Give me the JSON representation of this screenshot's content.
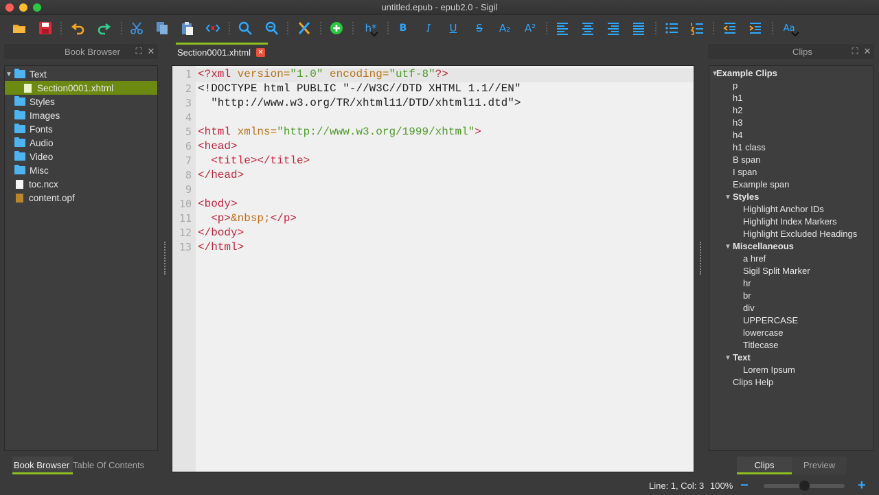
{
  "window": {
    "title": "untitled.epub - epub2.0 - Sigil"
  },
  "toolbar": {
    "heading_label": "h*",
    "bold_label": "B",
    "italic_label": "I",
    "underline_label": "U",
    "strike_label": "S",
    "subscript_label": "A₂",
    "superscript_label": "A²",
    "case_label": "Aa"
  },
  "left_panel": {
    "title": "Book Browser",
    "tree": [
      {
        "label": "Text",
        "type": "folder",
        "expanded": true
      },
      {
        "label": "Section0001.xhtml",
        "type": "file",
        "selected": true
      },
      {
        "label": "Styles",
        "type": "folder"
      },
      {
        "label": "Images",
        "type": "folder"
      },
      {
        "label": "Fonts",
        "type": "folder"
      },
      {
        "label": "Audio",
        "type": "folder"
      },
      {
        "label": "Video",
        "type": "folder"
      },
      {
        "label": "Misc",
        "type": "folder"
      },
      {
        "label": "toc.ncx",
        "type": "file"
      },
      {
        "label": "content.opf",
        "type": "file"
      }
    ],
    "tabs": [
      "Book Browser",
      "Table Of Contents"
    ]
  },
  "editor": {
    "tab_label": "Section0001.xhtml",
    "line_numbers": [
      "1",
      "2",
      "3",
      "4",
      "5",
      "6",
      "7",
      "8",
      "9",
      "10",
      "11",
      "12",
      "13"
    ],
    "lines": [
      {
        "tag_open": "<?xml ",
        "attr1": "version=",
        "str1": "\"1.0\"",
        "attr2": " encoding=",
        "str2": "\"utf-8\"",
        "tag_close": "?>"
      },
      {
        "text": "<!DOCTYPE html PUBLIC \"-//W3C//DTD XHTML 1.1//EN\""
      },
      {
        "text": "  \"http://www.w3.org/TR/xhtml11/DTD/xhtml11.dtd\">"
      },
      {
        "text": ""
      },
      {
        "tag_open": "<html ",
        "attr1": "xmlns=",
        "str1": "\"http://www.w3.org/1999/xhtml\"",
        "tag_close": ">"
      },
      {
        "tag": "<head>"
      },
      {
        "tag": "  <title></title>"
      },
      {
        "tag": "</head>"
      },
      {
        "text": ""
      },
      {
        "tag": "<body>"
      },
      {
        "tag_open": "  <p>",
        "entity": "&nbsp;",
        "tag_close": "</p>"
      },
      {
        "tag": "</body>"
      },
      {
        "tag": "</html>"
      }
    ]
  },
  "right_panel": {
    "title": "Clips",
    "clips": [
      {
        "label": "Example Clips",
        "level": 0,
        "group": true
      },
      {
        "label": "p",
        "level": 1
      },
      {
        "label": "h1",
        "level": 1
      },
      {
        "label": "h2",
        "level": 1
      },
      {
        "label": "h3",
        "level": 1
      },
      {
        "label": "h4",
        "level": 1
      },
      {
        "label": "h1 class",
        "level": 1
      },
      {
        "label": "B span",
        "level": 1
      },
      {
        "label": "I span",
        "level": 1
      },
      {
        "label": "Example span",
        "level": 1
      },
      {
        "label": "Styles",
        "level": 1,
        "group": true
      },
      {
        "label": "Highlight Anchor IDs",
        "level": 2
      },
      {
        "label": "Highlight Index Markers",
        "level": 2
      },
      {
        "label": "Highlight Excluded Headings",
        "level": 2
      },
      {
        "label": "Miscellaneous",
        "level": 1,
        "group": true
      },
      {
        "label": "a href",
        "level": 2
      },
      {
        "label": "Sigil Split Marker",
        "level": 2
      },
      {
        "label": "hr",
        "level": 2
      },
      {
        "label": "br",
        "level": 2
      },
      {
        "label": "div",
        "level": 2
      },
      {
        "label": "UPPERCASE",
        "level": 2
      },
      {
        "label": "lowercase",
        "level": 2
      },
      {
        "label": "Titlecase",
        "level": 2
      },
      {
        "label": "Text",
        "level": 1,
        "group": true
      },
      {
        "label": "Lorem Ipsum",
        "level": 2
      },
      {
        "label": "Clips Help",
        "level": 1
      }
    ],
    "tabs": [
      "Clips",
      "Preview"
    ]
  },
  "status": {
    "position": "Line: 1, Col: 3",
    "zoom": "100%",
    "zoom_minus": "−",
    "zoom_plus": "+"
  },
  "colors": {
    "accent": "#8fbf1f",
    "selection": "#6c8a12",
    "icon_blue": "#2fa9ff"
  }
}
